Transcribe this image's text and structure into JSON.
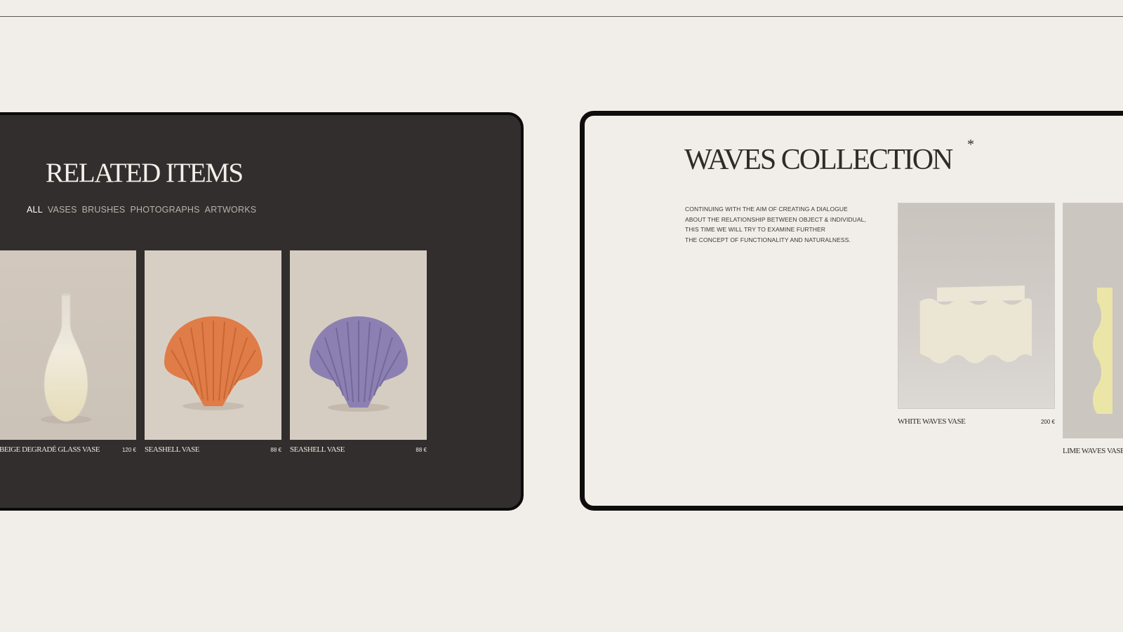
{
  "related": {
    "title": "RELATED ITEMS",
    "filters": [
      "ALL",
      "VASES",
      "BRUSHES",
      "PHOTOGRAPHS",
      "ARTWORKS"
    ],
    "items": [
      {
        "name": "BEIGE DEGRADÉ GLASS VASE",
        "price": "120 €"
      },
      {
        "name": "SEASHELL VASE",
        "price": "88 €"
      },
      {
        "name": "SEASHELL VASE",
        "price": "88 €"
      }
    ]
  },
  "collection": {
    "title": "WAVES COLLECTION",
    "asterisk": "*",
    "description": [
      "CONTINUING WITH THE AIM OF CREATING A DIALOGUE",
      "ABOUT THE RELATIONSHIP BETWEEN OBJECT & INDIVIDUAL,",
      "THIS TIME WE WILL TRY TO EXAMINE FURTHER",
      "THE CONCEPT OF FUNCTIONALITY AND NATURALNESS."
    ],
    "items": [
      {
        "name": "WHITE WAVES VASE",
        "price": "200 €"
      },
      {
        "name": "LIME WAVES VASE",
        "price": ""
      }
    ]
  },
  "colors": {
    "page_bg": "#f1ede9",
    "dark_panel": "#312e2d",
    "shell_orange": "#e07c47",
    "shell_lavender": "#8c80b3"
  }
}
